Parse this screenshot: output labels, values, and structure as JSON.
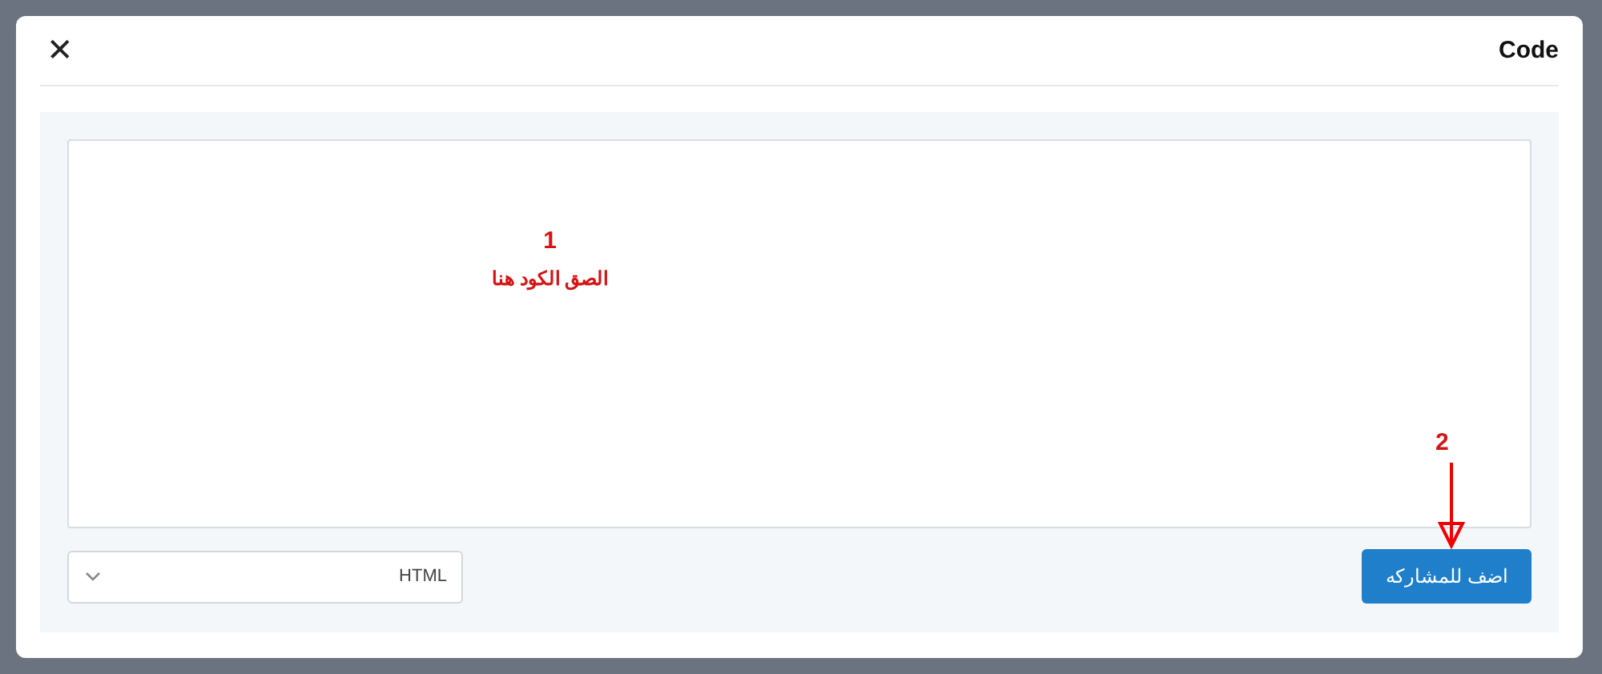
{
  "dialog": {
    "title": "Code",
    "close": "✕"
  },
  "editor": {
    "annotations": [
      {
        "number": "1",
        "text": "الصق الكود هنا"
      }
    ]
  },
  "language_select": {
    "value": "HTML"
  },
  "submit_button": {
    "label": "اضف للمشاركه",
    "annotation": {
      "number": "2"
    }
  }
}
